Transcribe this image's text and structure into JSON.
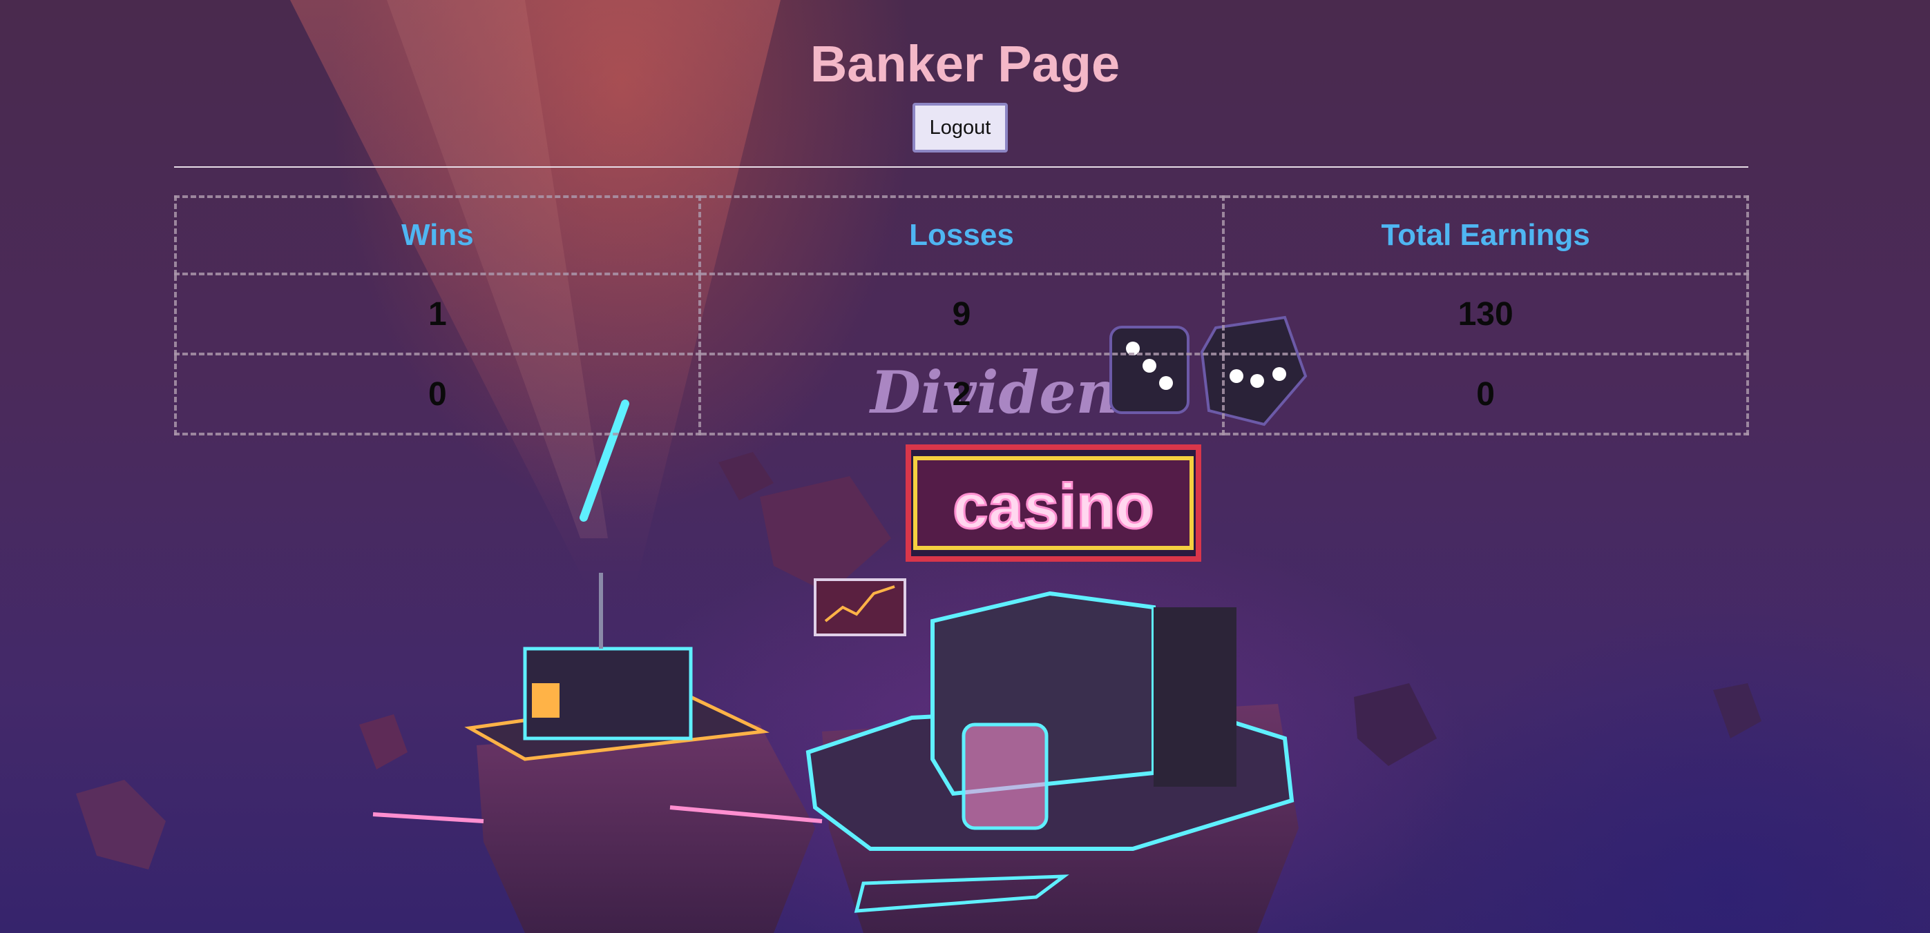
{
  "page": {
    "title": "Banker Page",
    "logout_label": "Logout"
  },
  "stats": {
    "headers": [
      "Wins",
      "Losses",
      "Total Earnings"
    ],
    "rows": [
      [
        "1",
        "9",
        "130"
      ],
      [
        "0",
        "2",
        "0"
      ]
    ]
  },
  "background": {
    "neon_sign_top": "Dividend",
    "neon_sign_main": "casino"
  },
  "colors": {
    "title": "#f4b8c8",
    "header_text": "#4fb6f2",
    "cell_text": "#0a0a0a",
    "neon_cyan": "#5ff0ff",
    "neon_pink": "#ff8fd0"
  }
}
